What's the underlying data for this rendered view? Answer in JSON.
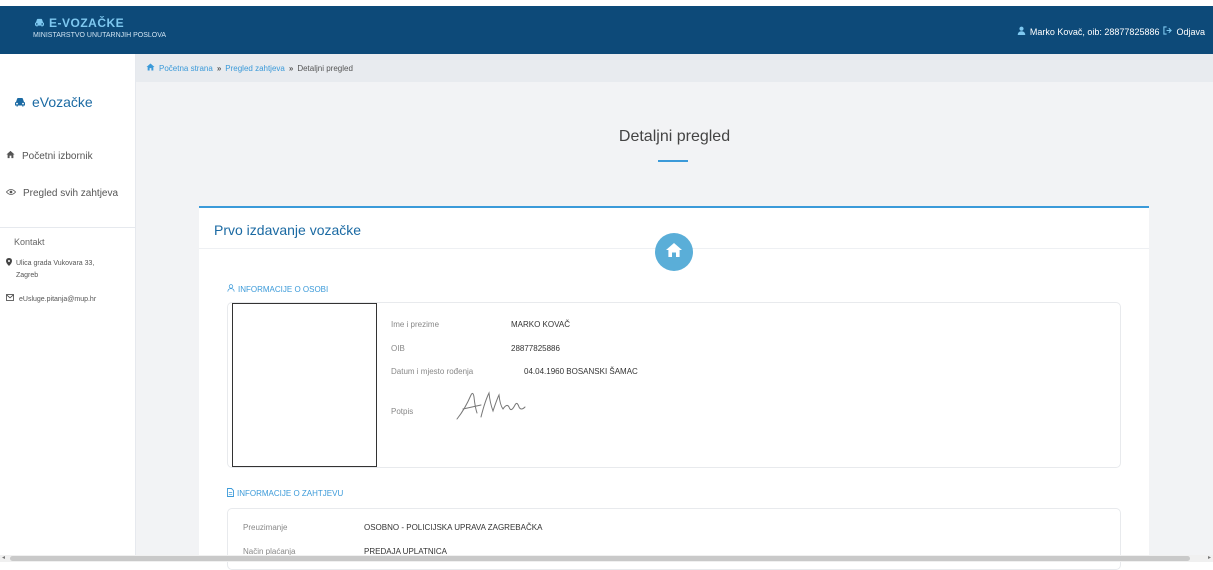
{
  "header": {
    "brand_title": "E-VOZAČKE",
    "brand_subtitle": "MINISTARSTVO UNUTARNJIH POSLOVA",
    "user_text": "Marko Kovač, oib: 28877825886",
    "logout_label": "Odjava"
  },
  "sidebar": {
    "brand": "eVozačke",
    "items": [
      {
        "label": "Početni izbornik",
        "icon": "home-icon"
      },
      {
        "label": "Pregled svih zahtjeva",
        "icon": "eye-icon"
      }
    ],
    "contact_title": "Kontakt",
    "address": "Ulica grada Vukovara 33, Zagreb",
    "email": "eUsluge.pitanja@mup.hr"
  },
  "breadcrumb": {
    "items": [
      "Početna strana",
      "Pregled zahtjeva",
      "Detaljni pregled"
    ]
  },
  "page": {
    "title": "Detaljni pregled"
  },
  "card": {
    "title": "Prvo izdavanje vozačke",
    "person_section": "INFORMACIJE O OSOBI",
    "person": {
      "name_label": "Ime i prezime",
      "name_value": "MARKO KOVAČ",
      "oib_label": "OIB",
      "oib_value": "28877825886",
      "birth_label": "Datum i mjesto rođenja",
      "birth_value": "04.04.1960 BOSANSKI ŠAMAC",
      "signature_label": "Potpis"
    },
    "request_section": "INFORMACIJE O ZAHTJEVU",
    "request": {
      "pickup_label": "Preuzimanje",
      "pickup_value": "OSOBNO - POLICIJSKA UPRAVA ZAGREBAČKA",
      "payment_label": "Način plaćanja",
      "payment_value": "PREDAJA UPLATNICA"
    }
  },
  "colors": {
    "header_bg": "#0d4a79",
    "accent": "#3b9ad9",
    "brand_light": "#7ec8f0"
  }
}
